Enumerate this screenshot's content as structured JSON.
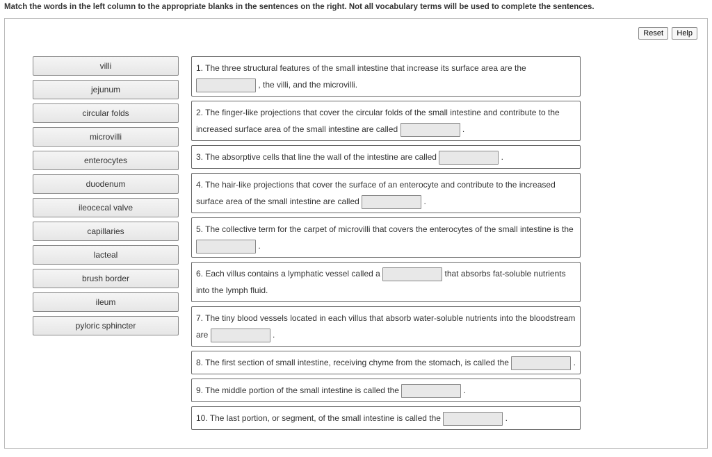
{
  "instruction": "Match the words in the left column to the appropriate blanks in the sentences on the right. Not all vocabulary terms will be used to complete the sentences.",
  "buttons": {
    "reset": "Reset",
    "help": "Help"
  },
  "terms": [
    "villi",
    "jejunum",
    "circular folds",
    "microvilli",
    "enterocytes",
    "duodenum",
    "ileocecal valve",
    "capillaries",
    "lacteal",
    "brush border",
    "ileum",
    "pyloric sphincter"
  ],
  "sentences": {
    "s1a": "1. The three structural features of the small intestine that increase its surface area are the ",
    "s1b": " , the villi, and the microvilli.",
    "s2a": "2. The finger-like projections that cover the circular folds of the small intestine and contribute to the increased surface area of the small intestine are called ",
    "s2b": " .",
    "s3a": "3. The absorptive cells that line the wall of the intestine are called ",
    "s3b": " .",
    "s4a": "4. The hair-like projections that cover the surface of an enterocyte and contribute to the increased surface area of the small intestine are called ",
    "s4b": " .",
    "s5a": "5. The collective term for the carpet of microvilli that covers the enterocytes of the small intestine is the ",
    "s5b": " .",
    "s6a": "6. Each villus contains a lymphatic vessel called a ",
    "s6b": " that absorbs fat-soluble nutrients into the lymph fluid.",
    "s7a": "7. The tiny blood vessels located in each villus that absorb water-soluble nutrients into the bloodstream are ",
    "s7b": " .",
    "s8a": "8. The first section of small intestine, receiving chyme from the stomach, is called the ",
    "s8b": " .",
    "s9a": "9. The middle portion of the small intestine is called the ",
    "s9b": " .",
    "s10a": "10. The last portion, or segment, of the small intestine is called the ",
    "s10b": " ."
  }
}
